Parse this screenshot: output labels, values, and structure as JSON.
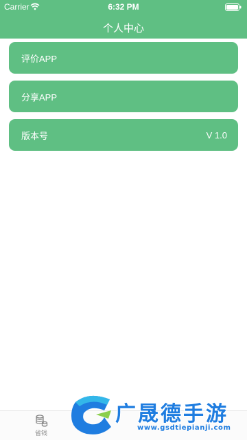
{
  "status_bar": {
    "carrier": "Carrier",
    "time": "6:32 PM"
  },
  "nav": {
    "title": "个人中心"
  },
  "menu": {
    "items": [
      {
        "label": "评价APP",
        "value": ""
      },
      {
        "label": "分享APP",
        "value": ""
      },
      {
        "label": "版本号",
        "value": "V 1.0"
      }
    ]
  },
  "tab_bar": {
    "items": [
      {
        "label": "省钱",
        "icon": "coins-stack-icon"
      }
    ]
  },
  "watermark": {
    "title": "广晟德手游",
    "url": "www.gsdtiepianji.com"
  },
  "colors": {
    "primary": "#5fbf83",
    "watermark_blue": "#1f7de0",
    "background": "#ffffff"
  }
}
